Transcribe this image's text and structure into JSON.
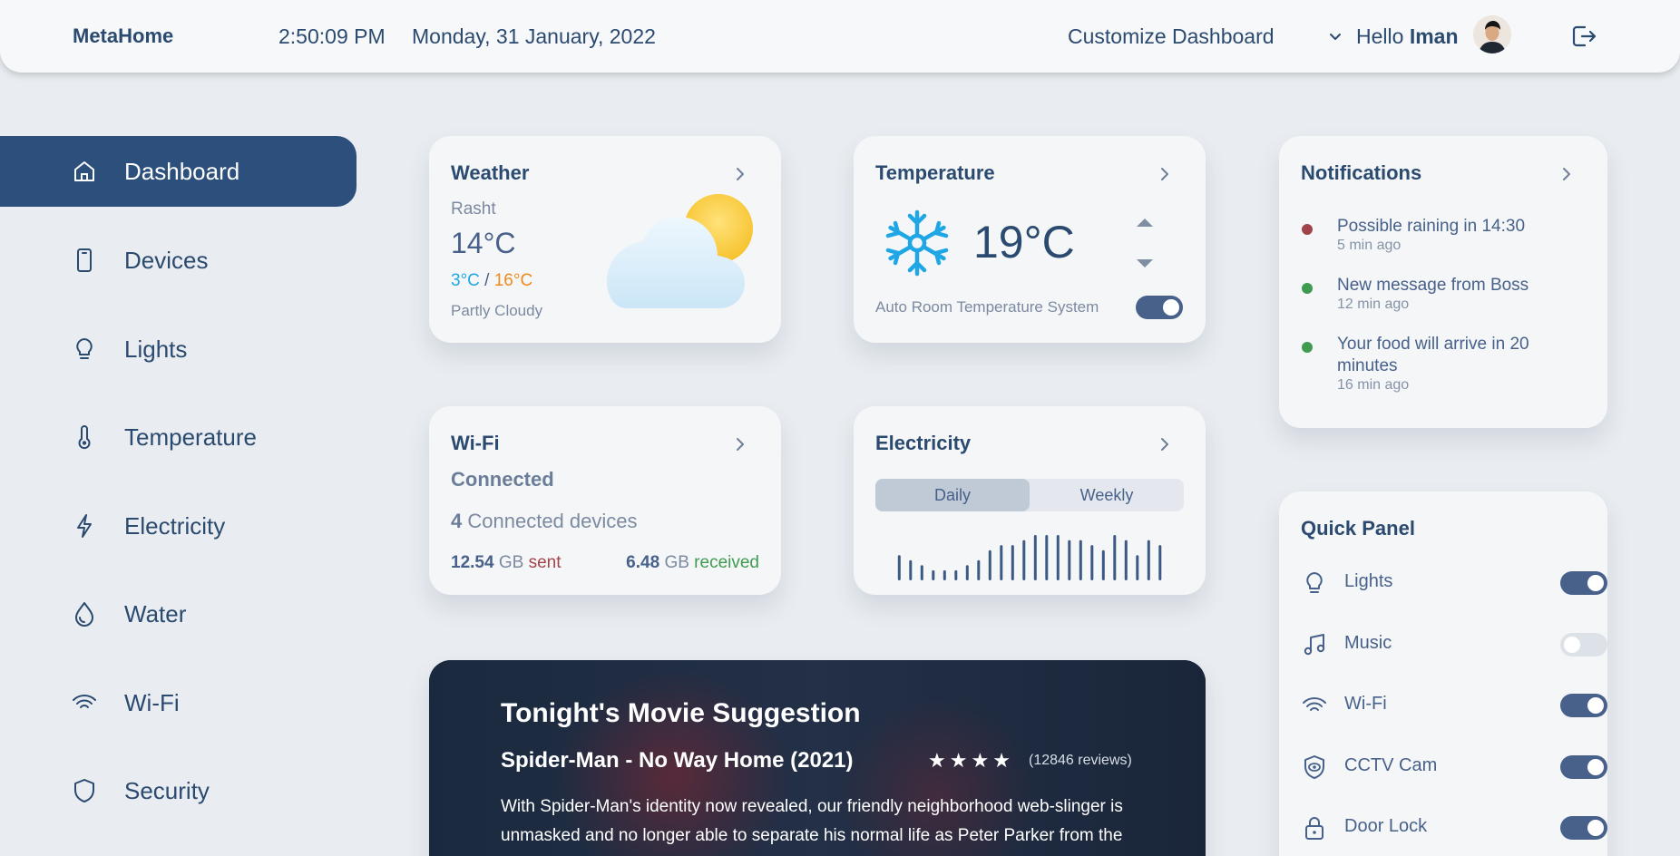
{
  "header": {
    "brand": "MetaHome",
    "time": "2:50:09 PM",
    "date": "Monday, 31 January, 2022",
    "customize": "Customize Dashboard",
    "hello": "Hello",
    "user_name": "Iman"
  },
  "sidebar": {
    "items": [
      {
        "label": "Dashboard",
        "icon": "home-icon"
      },
      {
        "label": "Devices",
        "icon": "phone-icon"
      },
      {
        "label": "Lights",
        "icon": "lightbulb-icon"
      },
      {
        "label": "Temperature",
        "icon": "thermometer-icon"
      },
      {
        "label": "Electricity",
        "icon": "bolt-icon"
      },
      {
        "label": "Water",
        "icon": "droplet-icon"
      },
      {
        "label": "Wi-Fi",
        "icon": "wifi-icon"
      },
      {
        "label": "Security",
        "icon": "shield-icon"
      }
    ]
  },
  "weather": {
    "title": "Weather",
    "city": "Rasht",
    "temp": "14°C",
    "min": "3°C",
    "sep": "/",
    "max": "16°C",
    "condition": "Partly Cloudy",
    "colors": {
      "min": "#1ea7e4",
      "max": "#f08a1c"
    }
  },
  "temperature": {
    "title": "Temperature",
    "value": "19°C",
    "auto_label": "Auto Room Temperature System",
    "auto_on": true
  },
  "wifi": {
    "title": "Wi-Fi",
    "status": "Connected",
    "device_count": "4",
    "devices_label": "Connected devices",
    "sent_value": "12.54",
    "sent_unit": "GB",
    "sent_label": "sent",
    "received_value": "6.48",
    "received_unit": "GB",
    "received_label": "received",
    "colors": {
      "sent": "#a0444a",
      "received": "#3f9b4f"
    }
  },
  "electricity": {
    "title": "Electricity",
    "tabs": [
      "Daily",
      "Weekly"
    ],
    "active_tab": "Daily",
    "chart_data": {
      "type": "bar",
      "values": [
        5,
        4,
        3,
        2,
        2,
        2,
        3,
        4,
        6,
        7,
        7,
        8,
        9,
        9,
        9,
        8,
        8,
        7,
        6,
        9,
        8,
        5,
        8,
        7
      ]
    }
  },
  "notifications": {
    "title": "Notifications",
    "items": [
      {
        "text": "Possible raining in 14:30",
        "time": "5 min ago",
        "color": "#a0444a"
      },
      {
        "text": "New message from Boss",
        "time": "12 min ago",
        "color": "#3f9b4f"
      },
      {
        "text": "Your food will arrive in 20 minutes",
        "time": "16 min ago",
        "color": "#3f9b4f"
      }
    ]
  },
  "quick_panel": {
    "title": "Quick Panel",
    "items": [
      {
        "label": "Lights",
        "icon": "lightbulb-icon",
        "on": true
      },
      {
        "label": "Music",
        "icon": "music-icon",
        "on": false
      },
      {
        "label": "Wi-Fi",
        "icon": "wifi-icon",
        "on": true
      },
      {
        "label": "CCTV Cam",
        "icon": "eye-shield-icon",
        "on": true
      },
      {
        "label": "Door Lock",
        "icon": "lock-icon",
        "on": true
      }
    ]
  },
  "movie": {
    "title": "Tonight's Movie Suggestion",
    "name": "Spider-Man - No Way Home (2021)",
    "rating_stars": 4,
    "reviews": "(12846 reviews)",
    "description": "With Spider-Man's identity now revealed, our friendly neighborhood web-slinger is unmasked and no longer able to separate his normal life as Peter Parker from the high"
  }
}
